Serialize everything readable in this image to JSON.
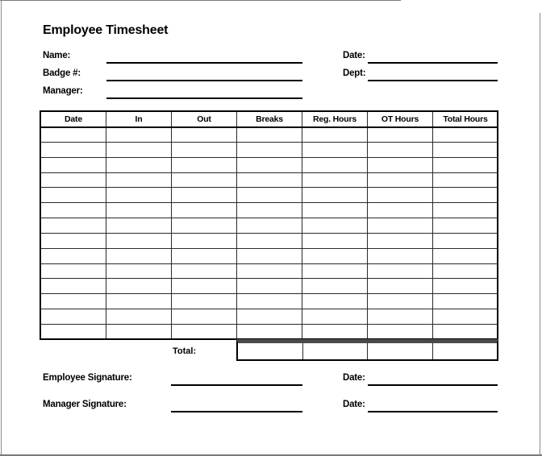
{
  "document": {
    "title": "Employee Timesheet"
  },
  "header_fields": {
    "name": {
      "label": "Name:",
      "value": ""
    },
    "badge": {
      "label": "Badge #:",
      "value": ""
    },
    "manager": {
      "label": "Manager:",
      "value": ""
    },
    "date": {
      "label": "Date:",
      "value": ""
    },
    "dept": {
      "label": "Dept:",
      "value": ""
    }
  },
  "table": {
    "columns": [
      "Date",
      "In",
      "Out",
      "Breaks",
      "Reg. Hours",
      "OT Hours",
      "Total Hours"
    ],
    "rows": [
      [
        "",
        "",
        "",
        "",
        "",
        "",
        ""
      ],
      [
        "",
        "",
        "",
        "",
        "",
        "",
        ""
      ],
      [
        "",
        "",
        "",
        "",
        "",
        "",
        ""
      ],
      [
        "",
        "",
        "",
        "",
        "",
        "",
        ""
      ],
      [
        "",
        "",
        "",
        "",
        "",
        "",
        ""
      ],
      [
        "",
        "",
        "",
        "",
        "",
        "",
        ""
      ],
      [
        "",
        "",
        "",
        "",
        "",
        "",
        ""
      ],
      [
        "",
        "",
        "",
        "",
        "",
        "",
        ""
      ],
      [
        "",
        "",
        "",
        "",
        "",
        "",
        ""
      ],
      [
        "",
        "",
        "",
        "",
        "",
        "",
        ""
      ],
      [
        "",
        "",
        "",
        "",
        "",
        "",
        ""
      ],
      [
        "",
        "",
        "",
        "",
        "",
        "",
        ""
      ],
      [
        "",
        "",
        "",
        "",
        "",
        "",
        ""
      ],
      [
        "",
        "",
        "",
        "",
        "",
        "",
        ""
      ]
    ],
    "total_label": "Total:",
    "totals": {
      "breaks": "",
      "reg_hours": "",
      "ot_hours": "",
      "total_hours": ""
    }
  },
  "signatures": {
    "employee": {
      "label": "Employee Signature:",
      "value": ""
    },
    "employee_date": {
      "label": "Date:",
      "value": ""
    },
    "manager": {
      "label": "Manager Signature:",
      "value": ""
    },
    "manager_date": {
      "label": "Date:",
      "value": ""
    }
  }
}
